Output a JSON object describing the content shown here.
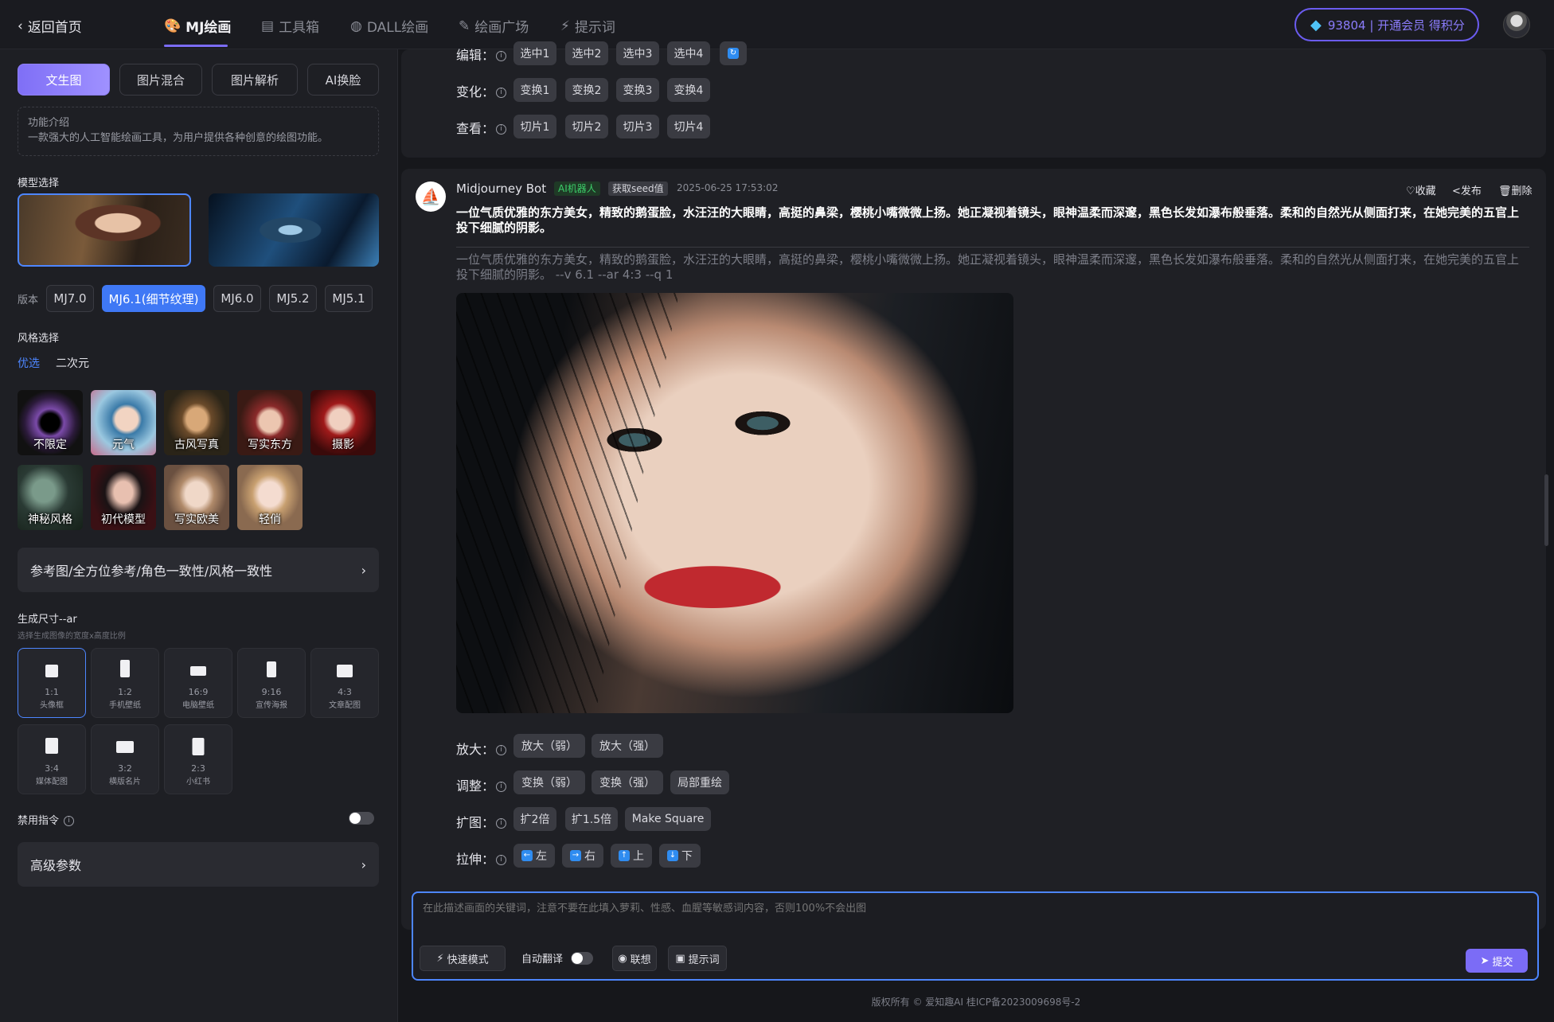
{
  "nav": {
    "back": "返回首页",
    "tabs": [
      "MJ绘画",
      "工具箱",
      "DALL绘画",
      "绘画广场",
      "提示词"
    ],
    "member": "93804 | 开通会员 得积分"
  },
  "sidebar": {
    "tabs": [
      "文生图",
      "图片混合",
      "图片解析",
      "AI换脸"
    ],
    "intro_title": "功能介绍",
    "intro_text": "一款强大的人工智能绘画工具，为用户提供各种创意的绘图功能。",
    "model_title": "模型选择",
    "version_label": "版本",
    "versions": [
      "MJ7.0",
      "MJ6.1(细节纹理)",
      "MJ6.0",
      "MJ5.2",
      "MJ5.1"
    ],
    "style_title": "风格选择",
    "style_tabs": [
      "优选",
      "二次元"
    ],
    "styles": [
      "不限定",
      "元气",
      "古风写真",
      "写实东方",
      "摄影",
      "神秘风格",
      "初代模型",
      "写实欧美",
      "轻俏"
    ],
    "reference": "参考图/全方位参考/角色一致性/风格一致性",
    "size_title": "生成尺寸--ar",
    "size_sub": "选择生成图像的宽度x高度比例",
    "sizes": [
      {
        "ratio": "1:1",
        "name": "头像框"
      },
      {
        "ratio": "1:2",
        "name": "手机壁纸"
      },
      {
        "ratio": "16:9",
        "name": "电脑壁纸"
      },
      {
        "ratio": "9:16",
        "name": "宣传海报"
      },
      {
        "ratio": "4:3",
        "name": "文章配图"
      },
      {
        "ratio": "3:4",
        "name": "媒体配图"
      },
      {
        "ratio": "3:2",
        "name": "横版名片"
      },
      {
        "ratio": "2:3",
        "name": "小红书"
      }
    ],
    "disable_cmd": "禁用指令",
    "advanced": "高级参数"
  },
  "prev_actions": {
    "edit_label": "编辑：",
    "edit": [
      "选中1",
      "选中2",
      "选中3",
      "选中4"
    ],
    "vary_label": "变化：",
    "vary": [
      "变换1",
      "变换2",
      "变换3",
      "变换4"
    ],
    "view_label": "查看：",
    "view": [
      "切片1",
      "切片2",
      "切片3",
      "切片4"
    ]
  },
  "message": {
    "author": "Midjourney Bot",
    "bot_badge": "AI机器人",
    "seed_badge": "获取seed值",
    "time": "2025-06-25 17:53:02",
    "collect": "收藏",
    "publish": "发布",
    "delete": "删除",
    "text": "一位气质优雅的东方美女，精致的鹅蛋脸，水汪汪的大眼睛，高挺的鼻梁，樱桃小嘴微微上扬。她正凝视着镜头，眼神温柔而深邃，黑色长发如瀑布般垂落。柔和的自然光从侧面打来，在她完美的五官上投下细腻的阴影。",
    "prompt": "一位气质优雅的东方美女，精致的鹅蛋脸，水汪汪的大眼睛，高挺的鼻梁，樱桃小嘴微微上扬。她正凝视着镜头，眼神温柔而深邃，黑色长发如瀑布般垂落。柔和的自然光从侧面打来，在她完美的五官上投下细腻的阴影。 --v 6.1 --ar 4:3 --q 1"
  },
  "actions": {
    "upscale_label": "放大：",
    "upscale": [
      "放大（弱）",
      "放大（强）"
    ],
    "adjust_label": "调整：",
    "adjust": [
      "变换（弱）",
      "变换（强）",
      "局部重绘"
    ],
    "expand_label": "扩图：",
    "expand": [
      "扩2倍",
      "扩1.5倍",
      "Make Square"
    ],
    "stretch_label": "拉伸：",
    "stretch": [
      "左",
      "右",
      "上",
      "下"
    ]
  },
  "input": {
    "placeholder": "在此描述画面的关键词，注意不要在此填入萝莉、性感、血腥等敏感词内容，否则100%不会出图",
    "fast_mode": "快速模式",
    "auto_translate": "自动翻译",
    "associate": "联想",
    "prompt_btn": "提示词",
    "submit": "提交"
  },
  "footer": "版权所有 © 爱知趣AI  桂ICP备2023009698号-2",
  "colors": {
    "accent": "#7b6cf6",
    "blue": "#3f78f5"
  }
}
